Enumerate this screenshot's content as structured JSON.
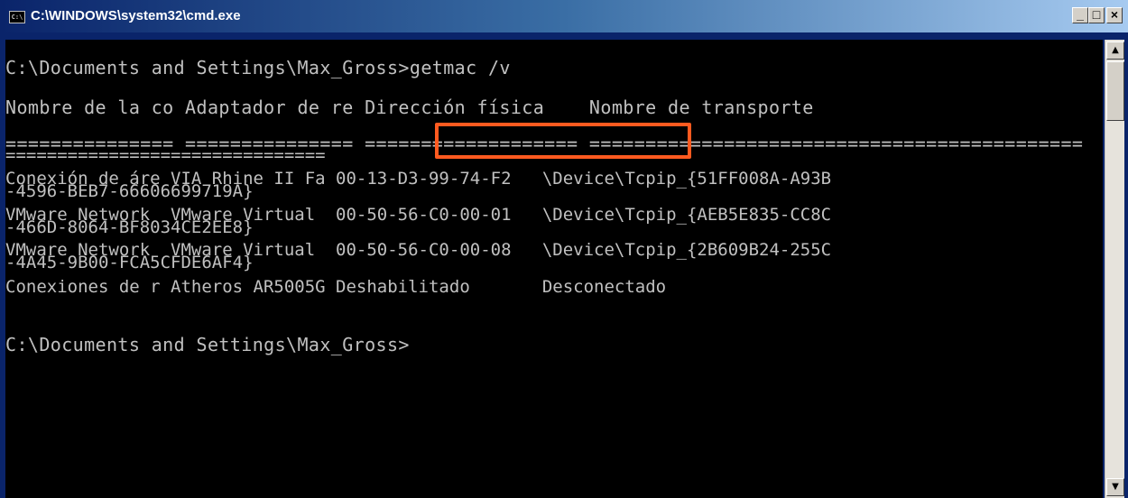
{
  "window": {
    "title": "C:\\WINDOWS\\system32\\cmd.exe",
    "icon_label": "C:\\",
    "buttons": {
      "minimize": "_",
      "maximize": "□",
      "close": "×"
    }
  },
  "console": {
    "lines": [
      "C:\\Documents and Settings\\Max_Gross>getmac /v",
      "Nombre de la co Adaptador de re Dirección física    Nombre de transporte",
      "=============== =============== =================== ============================================",
      "===============================",
      "Conexión de áre VIA Rhine II Fa 00-13-D3-99-74-F2   \\Device\\Tcpip_{51FF008A-A93B",
      "-4596-BEB7-66606699719A}",
      "VMware Network  VMware Virtual  00-50-56-C0-00-01   \\Device\\Tcpip_{AEB5E835-CC8C",
      "-466D-8064-BF8034CE2EE8}",
      "VMware Network  VMware Virtual  00-50-56-C0-00-08   \\Device\\Tcpip_{2B609B24-255C",
      "-4A45-9B00-FCA5CFDE6AF4}",
      "Conexiones de r Atheros AR5005G Deshabilitado       Desconectado",
      "",
      "C:\\Documents and Settings\\Max_Gross>"
    ]
  },
  "scrollbar": {
    "up_arrow": "▲",
    "down_arrow": "▼"
  },
  "colors": {
    "highlight_border": "#ff5a1f",
    "console_bg": "#000000",
    "console_text": "#c0c0c0"
  }
}
